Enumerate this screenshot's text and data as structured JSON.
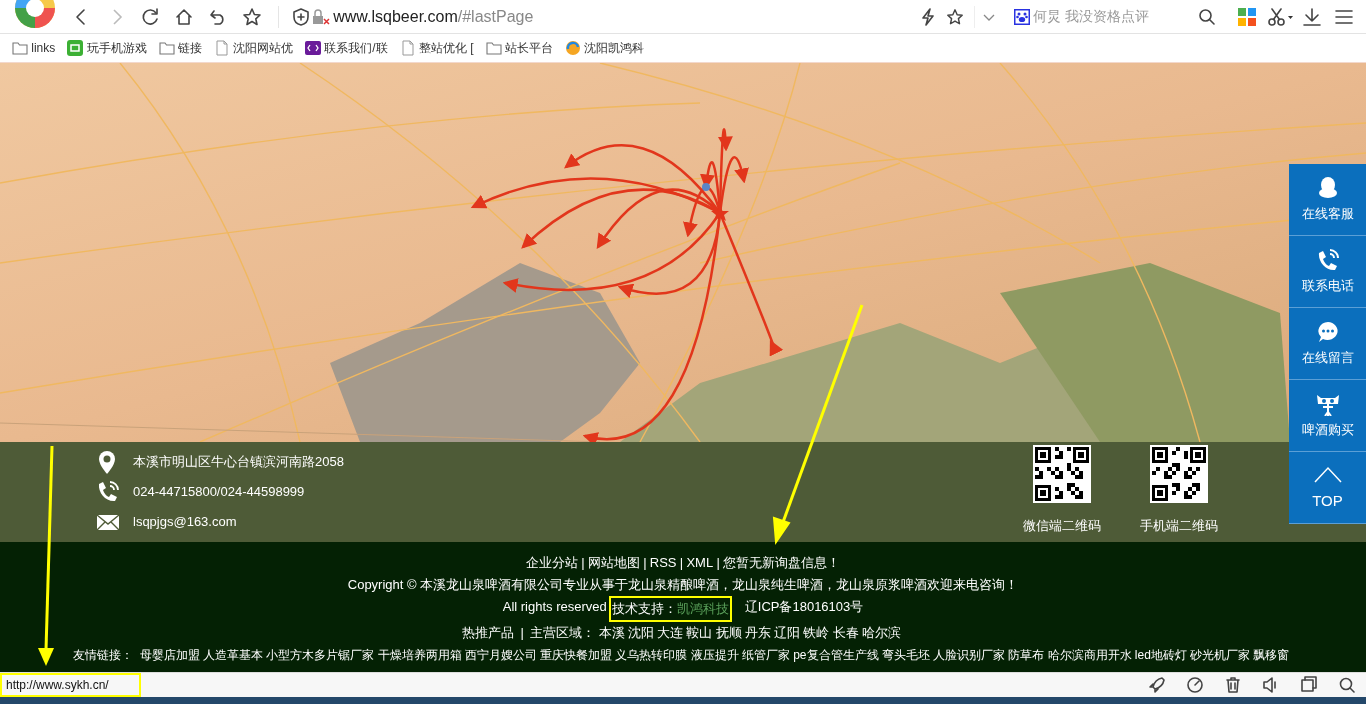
{
  "browser": {
    "url_domain": "www.lsqbeer.com",
    "url_path": "/#lastPage",
    "search_text": "何炅 我没资格点评"
  },
  "bookmarks": [
    {
      "label": "links",
      "kind": "folder"
    },
    {
      "label": "玩手机游戏",
      "kind": "game"
    },
    {
      "label": "链接",
      "kind": "folder"
    },
    {
      "label": "沈阳网站优",
      "kind": "page"
    },
    {
      "label": "联系我们/联",
      "kind": "app"
    },
    {
      "label": "整站优化 [",
      "kind": "page"
    },
    {
      "label": "站长平台",
      "kind": "folder"
    },
    {
      "label": "沈阳凯鸿科",
      "kind": "swirl"
    }
  ],
  "contact": [
    {
      "kind": "location",
      "text": "本溪市明山区牛心台镇滨河南路2058"
    },
    {
      "kind": "phone",
      "text": "024-44715800/024-44598999"
    },
    {
      "kind": "email",
      "text": "lsqpjgs@163.com"
    }
  ],
  "qr_codes": [
    {
      "label": "微信端二维码"
    },
    {
      "label": "手机端二维码"
    }
  ],
  "footer": {
    "separator": "|",
    "nav_links": [
      "企业分站",
      "网站地图",
      "RSS",
      "XML",
      "您暂无新询盘信息！"
    ],
    "copyright": "Copyright © 本溪龙山泉啤酒有限公司专业从事于龙山泉精酿啤酒，龙山泉纯生啤酒，龙山泉原浆啤酒欢迎来电咨询！",
    "rights": "All rights reserved",
    "support_label": "技术支持：",
    "support_link": "凯鸿科技",
    "icp": "辽ICP备18016103号",
    "hot_products": "热推产品",
    "region_label": "主营区域：",
    "regions": [
      "本溪",
      "沈阳",
      "大连",
      "鞍山",
      "抚顺",
      "丹东",
      "辽阳",
      "铁岭",
      "长春",
      "哈尔滨"
    ],
    "friend_label": "友情链接：",
    "friend_links": [
      "母婴店加盟",
      "人造革基本",
      "小型方木多片锯厂家",
      "干燥培养两用箱",
      "西宁月嫂公司",
      "重庆快餐加盟",
      "义乌热转印膜",
      "液压提升",
      "纸管厂家",
      "pe复合管生产线",
      "弯头毛坯",
      "人脸识别厂家",
      "防草布",
      "哈尔滨商用开水",
      "led地砖灯",
      "砂光机厂家",
      "飘移窗"
    ]
  },
  "float_bar": [
    {
      "kind": "qq",
      "label": "在线客服"
    },
    {
      "kind": "phone",
      "label": "联系电话"
    },
    {
      "kind": "chat",
      "label": "在线留言"
    },
    {
      "kind": "cat",
      "label": "啤酒购买"
    },
    {
      "kind": "top",
      "label": "TOP"
    }
  ],
  "status_bar": {
    "url": "http://www.sykh.cn/"
  }
}
